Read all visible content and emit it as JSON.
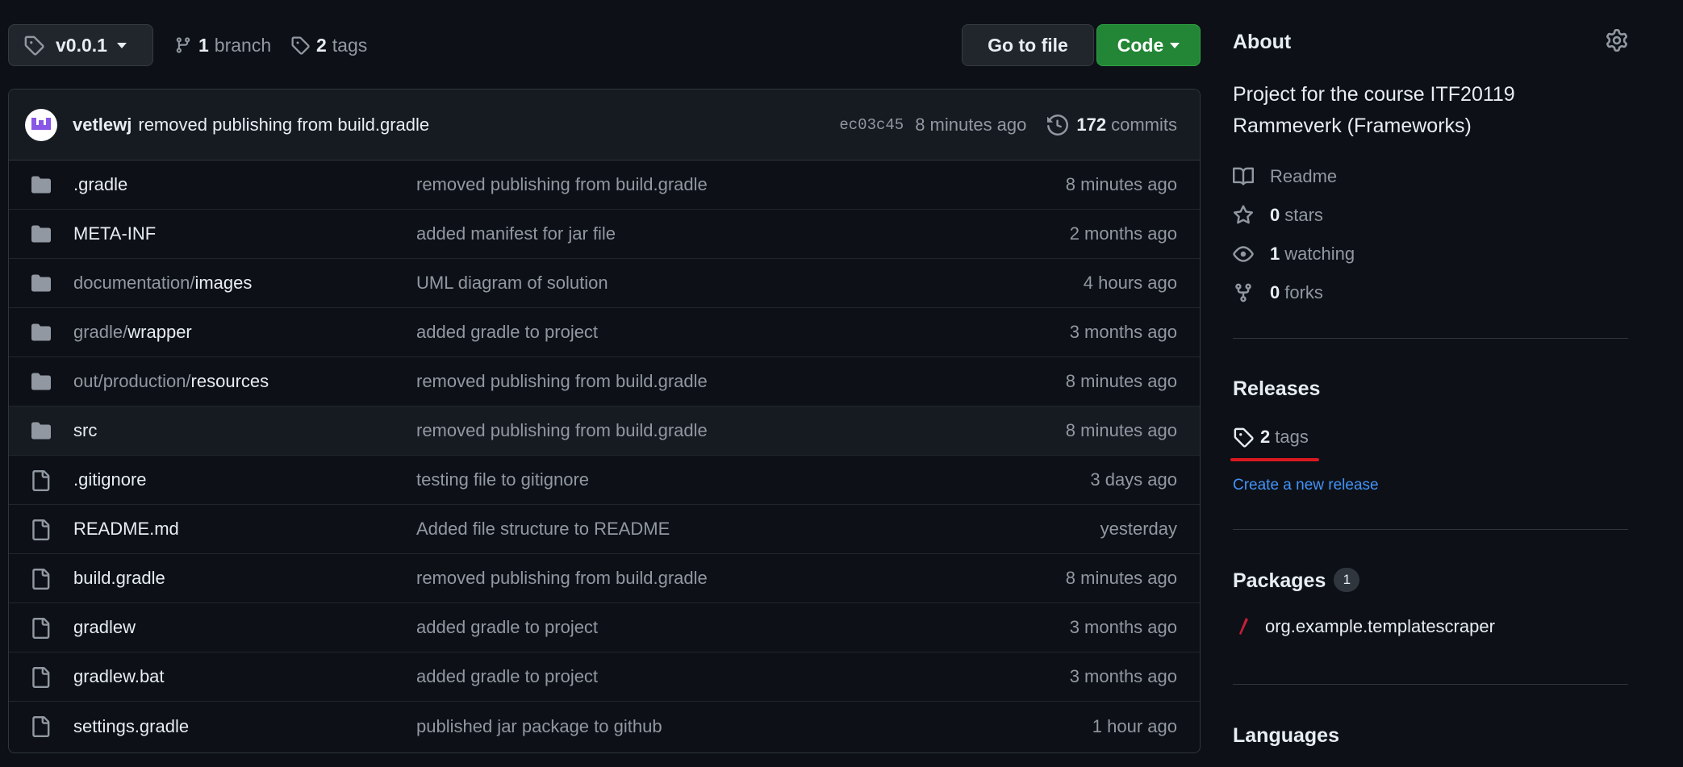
{
  "toolbar": {
    "branch_selector": "v0.0.1",
    "branch_count": "1",
    "branch_label": "branch",
    "tag_count": "2",
    "tag_label": "tags",
    "goto_file": "Go to file",
    "code_button": "Code"
  },
  "commit": {
    "author": "vetlewj",
    "message": "removed publishing from build.gradle",
    "sha": "ec03c45",
    "time": "8 minutes ago",
    "commit_count": "172",
    "commit_label": "commits"
  },
  "files": [
    {
      "type": "folder",
      "prefix": "",
      "name": ".gradle",
      "message": "removed publishing from build.gradle",
      "age": "8 minutes ago"
    },
    {
      "type": "folder",
      "prefix": "",
      "name": "META-INF",
      "message": "added manifest for jar file",
      "age": "2 months ago"
    },
    {
      "type": "folder",
      "prefix": "documentation/",
      "name": "images",
      "message": "UML diagram of solution",
      "age": "4 hours ago"
    },
    {
      "type": "folder",
      "prefix": "gradle/",
      "name": "wrapper",
      "message": "added gradle to project",
      "age": "3 months ago"
    },
    {
      "type": "folder",
      "prefix": "out/production/",
      "name": "resources",
      "message": "removed publishing from build.gradle",
      "age": "8 minutes ago"
    },
    {
      "type": "folder",
      "prefix": "",
      "name": "src",
      "message": "removed publishing from build.gradle",
      "age": "8 minutes ago"
    },
    {
      "type": "file",
      "prefix": "",
      "name": ".gitignore",
      "message": "testing file to gitignore",
      "age": "3 days ago"
    },
    {
      "type": "file",
      "prefix": "",
      "name": "README.md",
      "message": "Added file structure to README",
      "age": "yesterday"
    },
    {
      "type": "file",
      "prefix": "",
      "name": "build.gradle",
      "message": "removed publishing from build.gradle",
      "age": "8 minutes ago"
    },
    {
      "type": "file",
      "prefix": "",
      "name": "gradlew",
      "message": "added gradle to project",
      "age": "3 months ago"
    },
    {
      "type": "file",
      "prefix": "",
      "name": "gradlew.bat",
      "message": "added gradle to project",
      "age": "3 months ago"
    },
    {
      "type": "file",
      "prefix": "",
      "name": "settings.gradle",
      "message": "published jar package to github",
      "age": "1 hour ago"
    }
  ],
  "about": {
    "heading": "About",
    "description": "Project for the course ITF20119 Rammeverk (Frameworks)",
    "readme": "Readme",
    "stars_count": "0",
    "stars_label": "stars",
    "watching_count": "1",
    "watching_label": "watching",
    "forks_count": "0",
    "forks_label": "forks"
  },
  "releases": {
    "heading": "Releases",
    "tags_count": "2",
    "tags_label": "tags",
    "create_link": "Create a new release"
  },
  "packages": {
    "heading": "Packages",
    "count": "1",
    "item": "org.example.templatescraper"
  },
  "languages": {
    "heading": "Languages"
  },
  "icons": {
    "folder": "folder-icon",
    "file": "file-icon",
    "tag": "tag-icon",
    "branch": "branch-icon",
    "history": "history-icon",
    "gear": "gear-icon",
    "book": "book-icon",
    "star": "star-icon",
    "eye": "eye-icon",
    "fork": "fork-icon",
    "package": "package-icon"
  },
  "colors": {
    "background": "#0d1117",
    "accent_green": "#238636",
    "link_blue": "#4493f8",
    "muted_text": "#9198a1",
    "highlight_underline": "#d9191f"
  }
}
